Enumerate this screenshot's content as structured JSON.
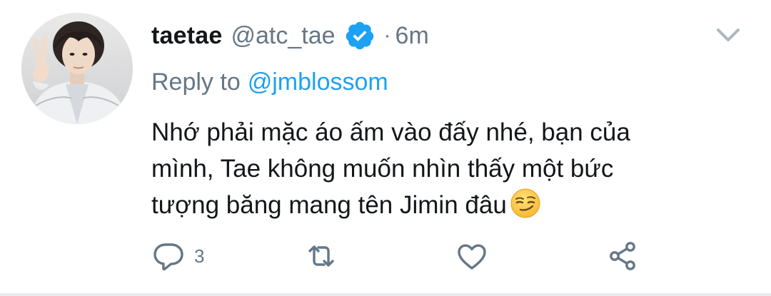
{
  "tweet": {
    "display_name": "taetae",
    "handle": "@atc_tae",
    "separator": "·",
    "time": "6m",
    "reply_label": "Reply to",
    "reply_to": "@jmblossom",
    "text": "Nhớ phải mặc áo ấm vào đấy nhé, bạn của mình, Tae không muốn nhìn thấy một bức tượng băng mang tên Jimin đâu",
    "text_emoji": "smirking-face-emoji"
  },
  "actions": {
    "reply_count": "3",
    "icons": [
      "reply-icon",
      "retweet-icon",
      "like-icon",
      "share-icon"
    ]
  },
  "colors": {
    "accent": "#1da1f2",
    "muted": "#657786",
    "text": "#14171a"
  }
}
